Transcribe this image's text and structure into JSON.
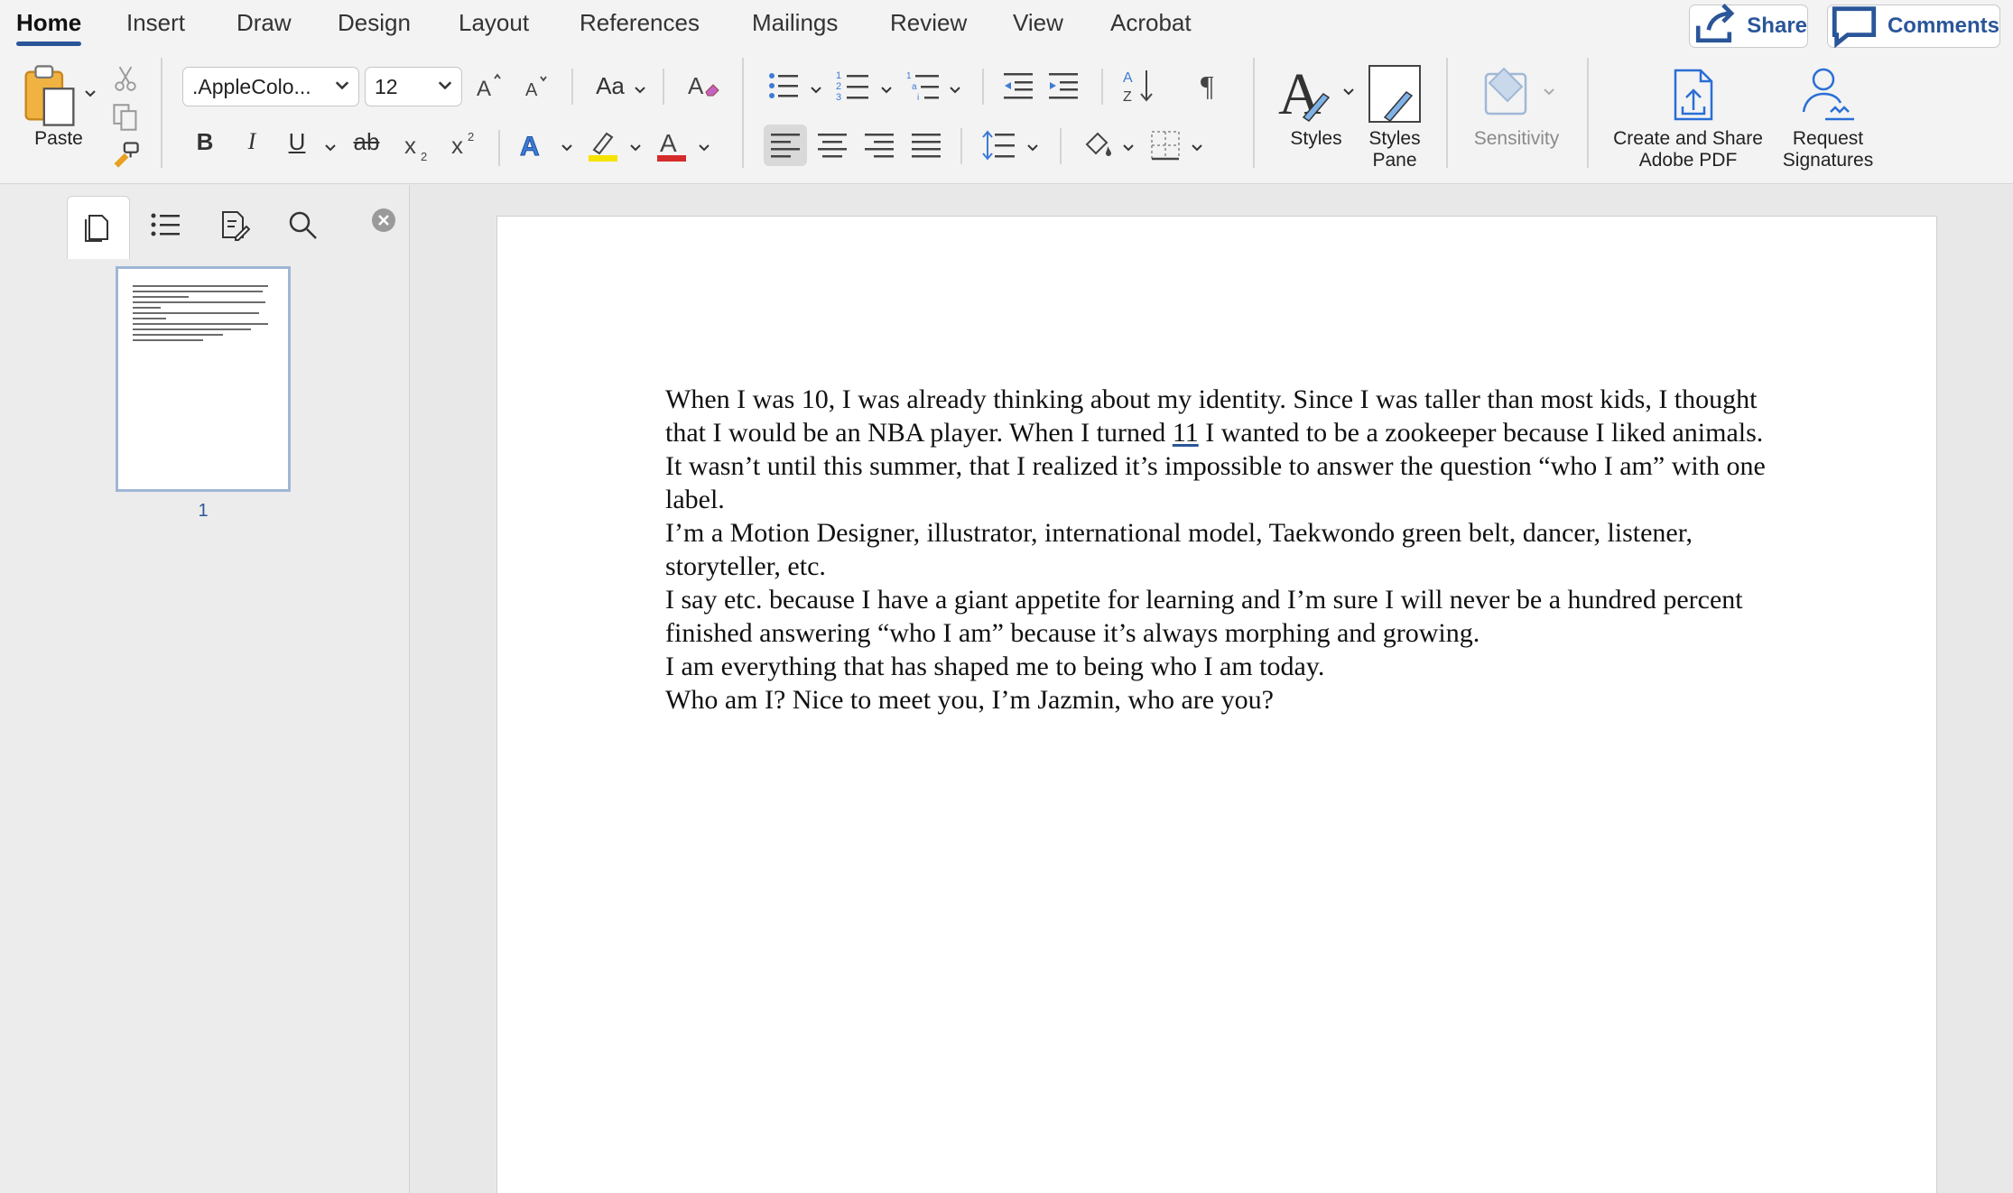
{
  "tabs": [
    "Home",
    "Insert",
    "Draw",
    "Design",
    "Layout",
    "References",
    "Mailings",
    "Review",
    "View",
    "Acrobat"
  ],
  "header": {
    "share_label": "Share",
    "comments_label": "Comments",
    "accent": "#2a5699"
  },
  "ribbon": {
    "paste_label": "Paste",
    "font_name": ".AppleColo...",
    "font_size": "12",
    "change_case_label": "Aa",
    "styles_label": "Styles",
    "styles_pane_label_1": "Styles",
    "styles_pane_label_2": "Pane",
    "sensitivity_label": "Sensitivity",
    "adobe_label_1": "Create and Share",
    "adobe_label_2": "Adobe PDF",
    "signatures_label_1": "Request",
    "signatures_label_2": "Signatures",
    "highlight_color": "#f5e300",
    "font_color": "#d62b2b"
  },
  "nav": {
    "page_number": "1"
  },
  "document": {
    "p1_a": "When I was 10, I was already thinking about my identity. Since I was taller than most kids, I thought that I would be an NBA player. When I turned ",
    "p1_u": "11",
    "p1_b": " I wanted to be a zookeeper because I liked animals.",
    "p2": "It wasn’t until this summer, that I realized it’s impossible to answer the question “who I am” with one label.",
    "p3": "I’m a Motion Designer, illustrator, international model, Taekwondo green belt, dancer, listener, storyteller, etc.",
    "p4": "I say etc. because I have a giant appetite for learning and I’m sure I will never be a hundred percent finished answering “who I am” because it’s always morphing and growing.",
    "p5": "I am everything that has shaped me to being who I am today.",
    "p6": "Who am I?  Nice to meet you, I’m Jazmin, who are you?"
  }
}
